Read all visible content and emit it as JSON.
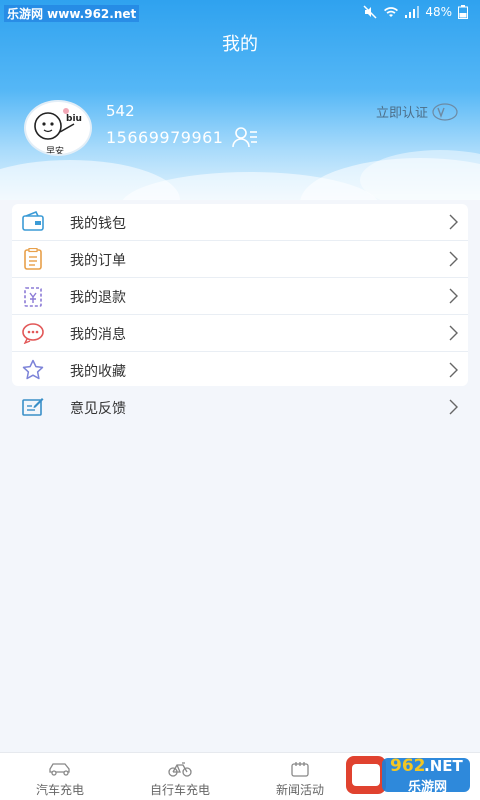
{
  "status_bar": {
    "watermark": "乐游网 www.962.net",
    "battery": "48%"
  },
  "header": {
    "title": "我的",
    "user_name": "542",
    "phone": "15669979961",
    "verify_label": "立即认证",
    "vip_badge": "V0",
    "avatar_caption": "早安",
    "avatar_text": "biu"
  },
  "menu": {
    "items": [
      {
        "label": "我的钱包",
        "icon": "wallet-icon"
      },
      {
        "label": "我的订单",
        "icon": "order-icon"
      },
      {
        "label": "我的退款",
        "icon": "refund-icon"
      },
      {
        "label": "我的消息",
        "icon": "message-icon"
      },
      {
        "label": "我的收藏",
        "icon": "star-icon"
      },
      {
        "label": "意见反馈",
        "icon": "feedback-icon"
      }
    ]
  },
  "tabbar": {
    "tabs": [
      {
        "label": "汽车充电",
        "icon": "car-icon"
      },
      {
        "label": "自行车充电",
        "icon": "bicycle-icon"
      },
      {
        "label": "新闻活动",
        "icon": "news-icon"
      }
    ]
  },
  "watermark_br": {
    "brand": "962",
    "suffix": ".NET",
    "text": "乐游网"
  },
  "colors": {
    "header_top": "#2fa2ef",
    "wallet": "#3c9bd6",
    "order": "#e8a04a",
    "refund": "#8c7bd6",
    "message": "#e25858",
    "star": "#7c83d8",
    "feedback": "#3a8fc8"
  }
}
